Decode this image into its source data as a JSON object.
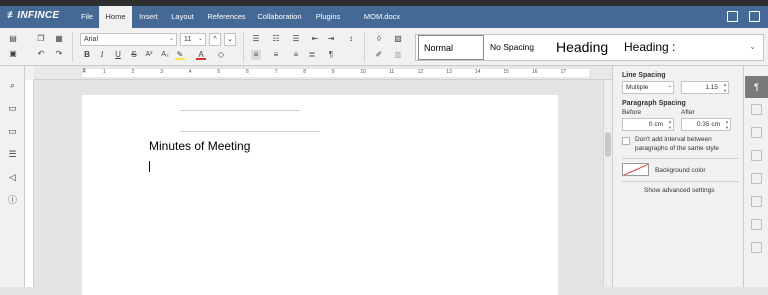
{
  "app": {
    "logo": "≢INFINCE",
    "document_title": "MOM.docx"
  },
  "menu": {
    "tabs": [
      "File",
      "Home",
      "Insert",
      "Layout",
      "References",
      "Collaboration",
      "Plugins"
    ],
    "active": "Home"
  },
  "toolbar": {
    "font_name": "Arial",
    "font_size": "11",
    "styles": [
      "Normal",
      "No Spacing",
      "Heading",
      "Heading :"
    ],
    "selected_style": "Normal"
  },
  "document": {
    "heading": "Minutes of Meeting"
  },
  "ruler": {
    "labels": [
      "1",
      "2",
      "3",
      "4",
      "5",
      "6",
      "7",
      "8",
      "9",
      "10",
      "11",
      "12",
      "13",
      "14",
      "15",
      "16",
      "17"
    ]
  },
  "paragraph_panel": {
    "line_spacing_label": "Line Spacing",
    "line_spacing_mode": "Multiple",
    "line_spacing_value": "1.15",
    "paragraph_spacing_label": "Paragraph Spacing",
    "before_label": "Before",
    "after_label": "After",
    "before_value": "0 cm",
    "after_value": "0.35 cm",
    "no_interval_label_line1": "Don't add interval between",
    "no_interval_label_line2": "paragraphs of the same style",
    "background_color_label": "Background color",
    "advanced_link": "Show advanced settings"
  },
  "colors": {
    "header": "#446995",
    "accent_text_highlight": "#f5e34a",
    "font_color": "#d63333",
    "active_tab": "#7a7a7a"
  }
}
